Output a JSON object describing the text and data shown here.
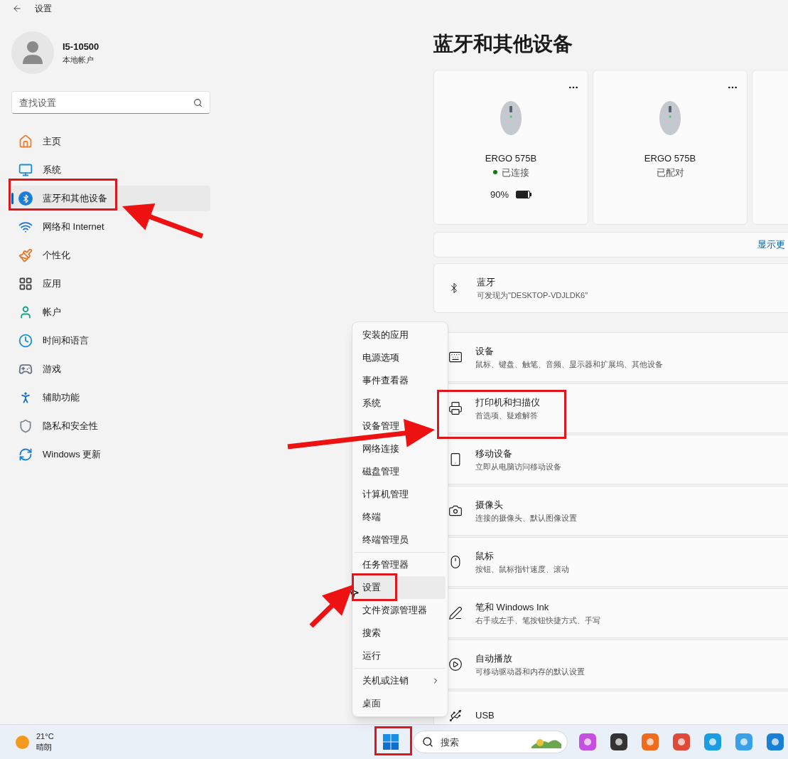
{
  "window": {
    "title": "设置"
  },
  "account": {
    "name": "I5-10500",
    "type": "本地帐户"
  },
  "search": {
    "placeholder": "查找设置"
  },
  "nav": [
    {
      "label": "主页",
      "selected": false
    },
    {
      "label": "系统",
      "selected": false
    },
    {
      "label": "蓝牙和其他设备",
      "selected": true
    },
    {
      "label": "网络和 Internet",
      "selected": false
    },
    {
      "label": "个性化",
      "selected": false
    },
    {
      "label": "应用",
      "selected": false
    },
    {
      "label": "帐户",
      "selected": false
    },
    {
      "label": "时间和语言",
      "selected": false
    },
    {
      "label": "游戏",
      "selected": false
    },
    {
      "label": "辅助功能",
      "selected": false
    },
    {
      "label": "隐私和安全性",
      "selected": false
    },
    {
      "label": "Windows 更新",
      "selected": false
    }
  ],
  "page_title": "蓝牙和其他设备",
  "devices": [
    {
      "name": "ERGO 575B",
      "status": "已连接",
      "connected": true,
      "battery": "90%",
      "level": 0.9
    },
    {
      "name": "ERGO 575B",
      "status": "已配对",
      "connected": false
    }
  ],
  "show_more": "显示更",
  "bluetooth": {
    "title": "蓝牙",
    "subtitle": "可发现为\"DESKTOP-VDJLDK6\""
  },
  "categories": [
    {
      "title": "设备",
      "subtitle": "鼠标、键盘、触笔、音频、显示器和扩展坞、其他设备"
    },
    {
      "title": "打印机和扫描仪",
      "subtitle": "首选项、疑难解答"
    },
    {
      "title": "移动设备",
      "subtitle": "立即从电脑访问移动设备"
    },
    {
      "title": "摄像头",
      "subtitle": "连接的摄像头、默认图像设置"
    },
    {
      "title": "鼠标",
      "subtitle": "按钮、鼠标指针速度、滚动"
    },
    {
      "title": "笔和 Windows Ink",
      "subtitle": "右手或左手、笔按钮快捷方式、手写"
    },
    {
      "title": "自动播放",
      "subtitle": "可移动驱动器和内存的默认设置"
    },
    {
      "title": "USB"
    }
  ],
  "context_menu": {
    "groups": [
      [
        {
          "label": "安装的应用",
          "selected": false
        },
        {
          "label": "电源选项",
          "selected": false
        },
        {
          "label": "事件查看器",
          "selected": false
        },
        {
          "label": "系统",
          "selected": false
        },
        {
          "label": "设备管理",
          "selected": false
        },
        {
          "label": "网络连接",
          "selected": false
        },
        {
          "label": "磁盘管理",
          "selected": false
        },
        {
          "label": "计算机管理",
          "selected": false
        },
        {
          "label": "终端",
          "selected": false
        },
        {
          "label": "终端管理员",
          "selected": false
        }
      ],
      [
        {
          "label": "任务管理器",
          "selected": false
        },
        {
          "label": "设置",
          "selected": true
        },
        {
          "label": "文件资源管理器",
          "selected": false
        },
        {
          "label": "搜索",
          "selected": false
        },
        {
          "label": "运行",
          "selected": false
        }
      ],
      [
        {
          "label": "关机或注销",
          "selected": false,
          "submenu": true
        },
        {
          "label": "桌面",
          "selected": false
        }
      ]
    ]
  },
  "taskbar": {
    "weather": {
      "temperature": "21°C",
      "condition": "晴朗"
    },
    "search": {
      "placeholder": "搜索"
    }
  }
}
